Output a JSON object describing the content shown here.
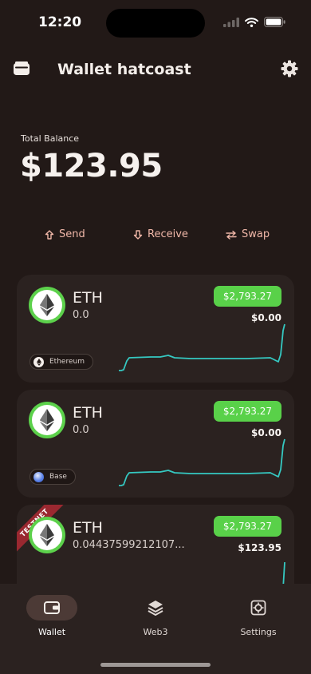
{
  "status": {
    "time": "12:20"
  },
  "header": {
    "title": "Wallet hatcoast"
  },
  "balance": {
    "label": "Total Balance",
    "value": "$123.95"
  },
  "actions": {
    "send": "Send",
    "receive": "Receive",
    "swap": "Swap"
  },
  "assets": [
    {
      "symbol": "ETH",
      "amount": "0.0",
      "price": "$2,793.27",
      "fiat": "$0.00",
      "network": "Ethereum"
    },
    {
      "symbol": "ETH",
      "amount": "0.0",
      "price": "$2,793.27",
      "fiat": "$0.00",
      "network": "Base"
    },
    {
      "symbol": "ETH",
      "amount": "0.04437599212107...",
      "price": "$2,793.27",
      "fiat": "$123.95",
      "badge": "TESTNET"
    }
  ],
  "tabs": {
    "wallet": "Wallet",
    "web3": "Web3",
    "settings": "Settings"
  },
  "colors": {
    "background": "#221917",
    "card": "#2b2220",
    "accent_green": "#59d149",
    "action_text": "#f0b7a8",
    "sparkline": "#35c9c2",
    "testnet_ribbon": "#9a2830"
  }
}
